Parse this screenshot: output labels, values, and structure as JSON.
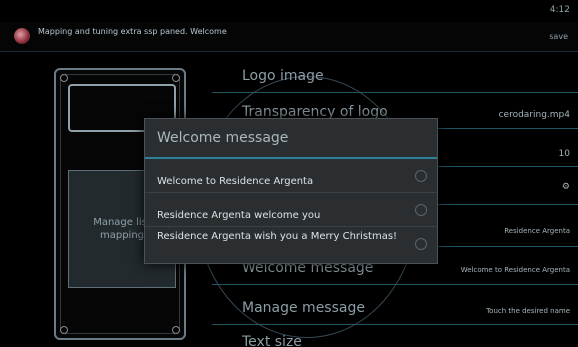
{
  "status_bar": {
    "time": "4:12"
  },
  "notification": {
    "text": "Mapping and tuning extra ssp paned. Welcome",
    "action": "save"
  },
  "device_preview": {
    "mapping_label": "Manage list mapping"
  },
  "preferences": [
    {
      "title": "Logo image",
      "value": ""
    },
    {
      "title": "Transparency of logo",
      "value": "cerodaring.mp4"
    },
    {
      "title": "",
      "value": "10"
    },
    {
      "title": "",
      "value": ""
    },
    {
      "title": "",
      "value": "Residence Argenta"
    },
    {
      "title": "Welcome message",
      "value": "Welcome to Residence Argenta"
    },
    {
      "title": "Manage message",
      "value": "Touch the desired name"
    },
    {
      "title": "Text size",
      "value": ""
    }
  ],
  "dialog": {
    "title": "Welcome message",
    "options": [
      {
        "label": "Welcome to Residence Argenta",
        "selected": false
      },
      {
        "label": "Residence Argenta welcome you",
        "selected": false
      },
      {
        "label": "Residence Argenta wish you a Merry Christmas!",
        "selected": false
      }
    ]
  },
  "colors": {
    "accent": "#2a7f9a",
    "divider": "#1f5565",
    "dialog_bg": "#2b2e30"
  },
  "icons": {
    "notification": "app-icon",
    "radio": "radio-button"
  }
}
